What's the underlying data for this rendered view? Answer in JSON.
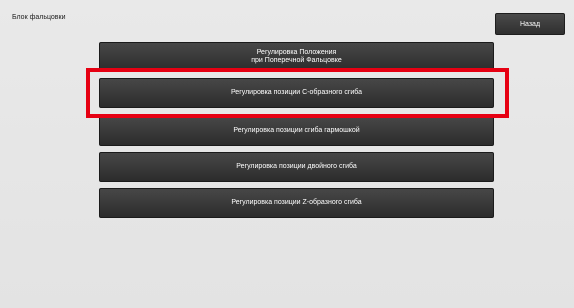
{
  "screen": {
    "title": "Блок фальцовки",
    "back_label": "Назад"
  },
  "menu": {
    "items": [
      {
        "lines": [
          "Регулировка Положения",
          "при Поперечной Фальцовке"
        ]
      },
      {
        "lines": [
          "Регулировка позиции C-образного сгиба"
        ]
      },
      {
        "lines": [
          "Регулировка позиции сгиба гармошкой"
        ]
      },
      {
        "lines": [
          "Регулировка позиции двойного сгиба"
        ]
      },
      {
        "lines": [
          "Регулировка позиции Z-образного сгиба"
        ]
      }
    ]
  },
  "colors": {
    "highlight": "#e60012",
    "button": "#3a3a3a",
    "background": "#e6e6e6"
  }
}
